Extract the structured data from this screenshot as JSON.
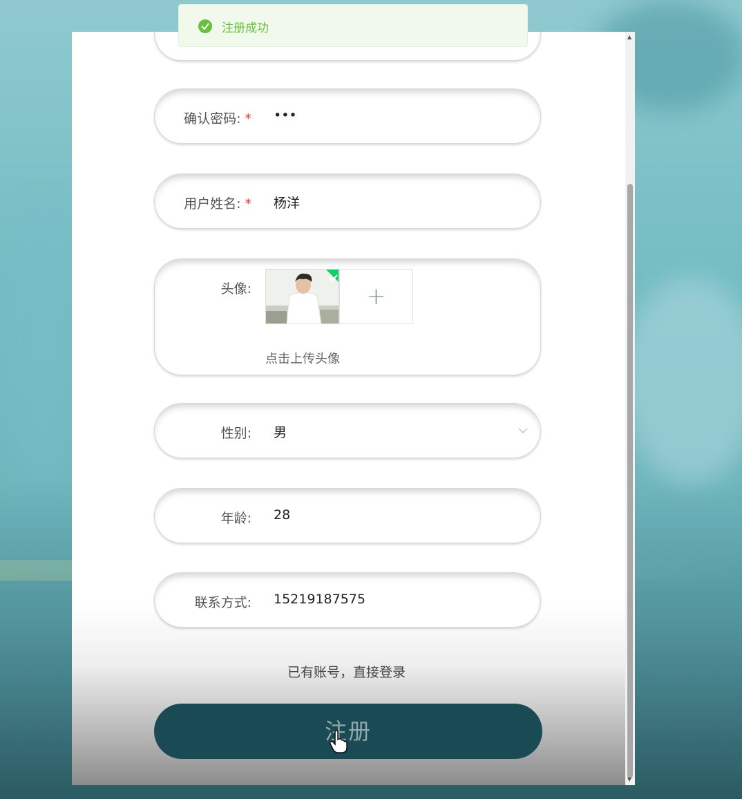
{
  "toast": {
    "message": "注册成功",
    "icon": "success-check-icon",
    "color": "#67c23a"
  },
  "form": {
    "confirm_password": {
      "label": "确认密码:",
      "required": "*",
      "value": "•••"
    },
    "real_name": {
      "label": "用户姓名:",
      "required": "*",
      "value": "杨洋"
    },
    "avatar": {
      "label": "头像:",
      "hint": "点击上传头像",
      "add_symbol": "+"
    },
    "gender": {
      "label": "性别:",
      "value": "男"
    },
    "age": {
      "label": "年龄:",
      "value": "28"
    },
    "phone": {
      "label": "联系方式:",
      "value": "15219187575"
    }
  },
  "login_link": "已有账号，直接登录",
  "submit_label": "注册",
  "colors": {
    "submit_bg": "#1a4b55",
    "required": "#e33333"
  }
}
